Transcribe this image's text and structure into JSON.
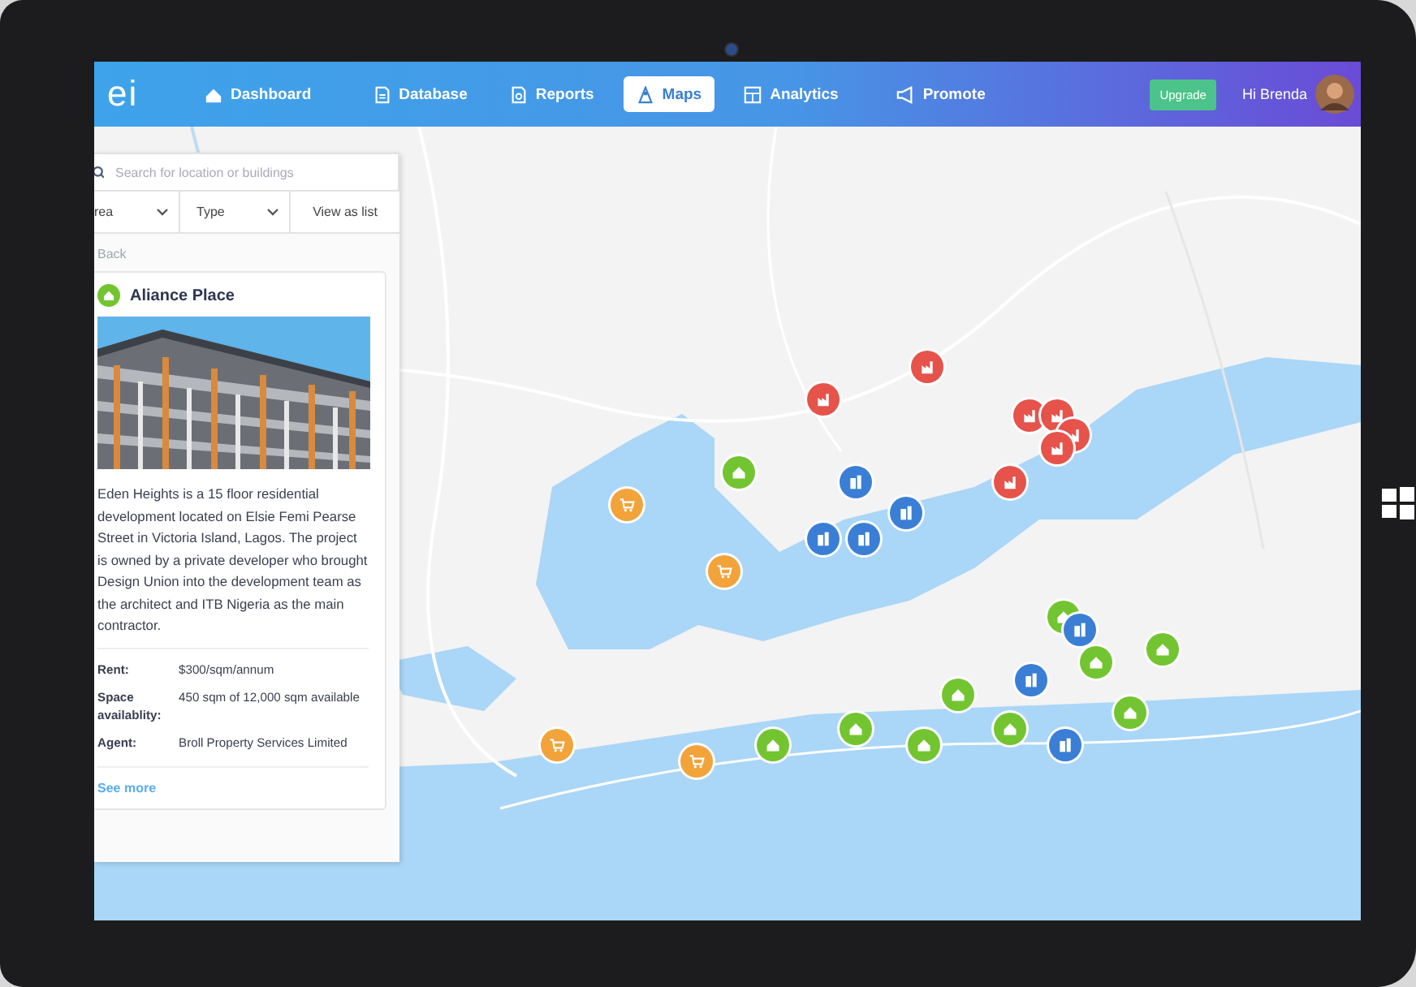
{
  "nav": {
    "logo": "ei",
    "items": [
      {
        "label": "Dashboard",
        "selected": false
      },
      {
        "label": "Database",
        "selected": false
      },
      {
        "label": "Reports",
        "selected": false
      },
      {
        "label": "Maps",
        "selected": true
      },
      {
        "label": "Analytics",
        "selected": false
      },
      {
        "label": "Promote",
        "selected": false
      }
    ],
    "upgrade": "Upgrade",
    "greeting": "Hi Brenda"
  },
  "sidebar": {
    "search": {
      "placeholder": "Search for location or buildings"
    },
    "filters": [
      {
        "label": "rea",
        "kind": "dropdown"
      },
      {
        "label": "Type",
        "kind": "dropdown"
      },
      {
        "label": "View as list",
        "kind": "link"
      }
    ],
    "back": "Back",
    "card": {
      "title": "Aliance Place",
      "description": "Eden Heights is a 15 floor residential development located on Elsie Femi Pearse Street in Victoria Island, Lagos. The project is owned by a private developer who brought Design Union into the development team as the architect and ITB Nigeria as the main contractor.",
      "details": [
        {
          "label": "Rent:",
          "value": "$300/sqm/annum"
        },
        {
          "label": "Space availablity:",
          "value": "450 sqm of 12,000 sqm available"
        },
        {
          "label": "Agent:",
          "value": "Broll Property Services Limited"
        }
      ],
      "more": "See more"
    }
  },
  "map": {
    "markers": [
      {
        "kind": "industrial",
        "color": "#e5534b"
      },
      {
        "kind": "industrial",
        "color": "#e5534b"
      },
      {
        "kind": "industrial",
        "color": "#e5534b"
      },
      {
        "kind": "industrial",
        "color": "#e5534b"
      },
      {
        "kind": "industrial",
        "color": "#e5534b"
      },
      {
        "kind": "industrial",
        "color": "#e5534b"
      },
      {
        "kind": "industrial",
        "color": "#e5534b"
      },
      {
        "kind": "residential",
        "color": "#72c531"
      },
      {
        "kind": "residential",
        "color": "#72c531"
      },
      {
        "kind": "residential",
        "color": "#72c531"
      },
      {
        "kind": "residential",
        "color": "#72c531"
      },
      {
        "kind": "residential",
        "color": "#72c531"
      },
      {
        "kind": "residential",
        "color": "#72c531"
      },
      {
        "kind": "residential",
        "color": "#72c531"
      },
      {
        "kind": "residential",
        "color": "#72c531"
      },
      {
        "kind": "residential",
        "color": "#72c531"
      },
      {
        "kind": "residential",
        "color": "#72c531"
      },
      {
        "kind": "office",
        "color": "#3a7fd5"
      },
      {
        "kind": "office",
        "color": "#3a7fd5"
      },
      {
        "kind": "office",
        "color": "#3a7fd5"
      },
      {
        "kind": "office",
        "color": "#3a7fd5"
      },
      {
        "kind": "office",
        "color": "#3a7fd5"
      },
      {
        "kind": "office",
        "color": "#3a7fd5"
      },
      {
        "kind": "office",
        "color": "#3a7fd5"
      },
      {
        "kind": "retail",
        "color": "#f2a33a"
      },
      {
        "kind": "retail",
        "color": "#f2a33a"
      },
      {
        "kind": "retail",
        "color": "#f2a33a"
      },
      {
        "kind": "retail",
        "color": "#f2a33a"
      }
    ]
  }
}
